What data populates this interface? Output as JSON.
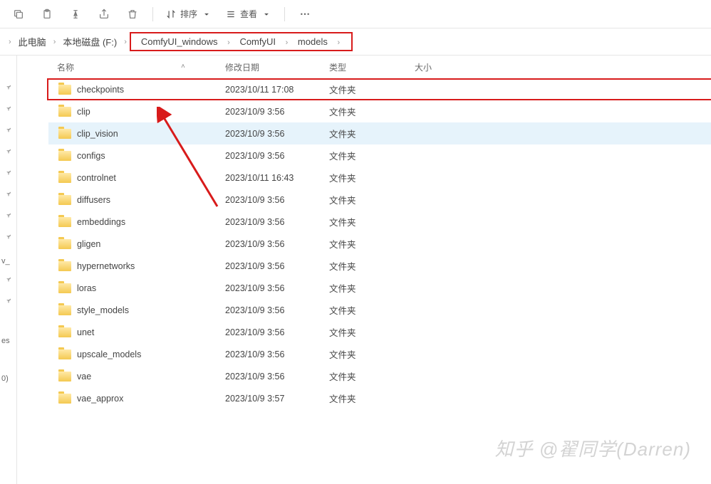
{
  "toolbar": {
    "sort_label": "排序",
    "view_label": "查看"
  },
  "breadcrumb": {
    "items": [
      "此电脑",
      "本地磁盘 (F:)",
      "ComfyUI_windows",
      "ComfyUI",
      "models"
    ]
  },
  "columns": {
    "name": "名称",
    "date": "修改日期",
    "type": "类型",
    "size": "大小"
  },
  "rows": [
    {
      "name": "checkpoints",
      "date": "2023/10/11 17:08",
      "type": "文件夹",
      "highlighted": true
    },
    {
      "name": "clip",
      "date": "2023/10/9 3:56",
      "type": "文件夹"
    },
    {
      "name": "clip_vision",
      "date": "2023/10/9 3:56",
      "type": "文件夹",
      "selected": true
    },
    {
      "name": "configs",
      "date": "2023/10/9 3:56",
      "type": "文件夹"
    },
    {
      "name": "controlnet",
      "date": "2023/10/11 16:43",
      "type": "文件夹"
    },
    {
      "name": "diffusers",
      "date": "2023/10/9 3:56",
      "type": "文件夹"
    },
    {
      "name": "embeddings",
      "date": "2023/10/9 3:56",
      "type": "文件夹"
    },
    {
      "name": "gligen",
      "date": "2023/10/9 3:56",
      "type": "文件夹"
    },
    {
      "name": "hypernetworks",
      "date": "2023/10/9 3:56",
      "type": "文件夹"
    },
    {
      "name": "loras",
      "date": "2023/10/9 3:56",
      "type": "文件夹"
    },
    {
      "name": "style_models",
      "date": "2023/10/9 3:56",
      "type": "文件夹"
    },
    {
      "name": "unet",
      "date": "2023/10/9 3:56",
      "type": "文件夹"
    },
    {
      "name": "upscale_models",
      "date": "2023/10/9 3:56",
      "type": "文件夹"
    },
    {
      "name": "vae",
      "date": "2023/10/9 3:56",
      "type": "文件夹"
    },
    {
      "name": "vae_approx",
      "date": "2023/10/9 3:57",
      "type": "文件夹"
    }
  ],
  "sidebar": {
    "label_w": "v_",
    "label_es": "es",
    "label_0": "0)"
  },
  "watermark": "知乎 @翟同学(Darren)"
}
